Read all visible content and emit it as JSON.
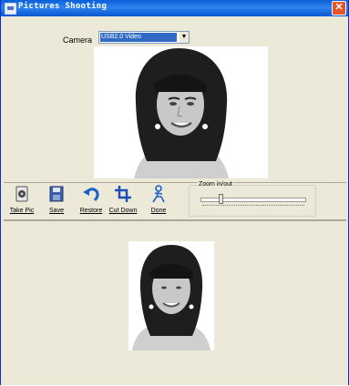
{
  "window": {
    "title": "Pictures Shooting",
    "close_glyph": "✕"
  },
  "camera": {
    "label": "Camera",
    "value": "USB2.0 Video"
  },
  "toolbar": {
    "take_pic_label": "Take Pic",
    "save_label": "Save",
    "restore_label": "Restore",
    "cut_down_label": "Cut Down",
    "done_label": "Done"
  },
  "zoom": {
    "label": "Zoom in/out",
    "level": 0.18
  },
  "icons": {
    "take_pic": "camera-icon",
    "save": "floppy-disk-icon",
    "restore": "undo-arrow-icon",
    "cut_down": "crop-icon",
    "done": "figure-icon"
  },
  "colors": {
    "titlebar": "#0a5fd8",
    "window_bg": "#ece9d8",
    "selection": "#316ac5",
    "close_button": "#e5542b"
  }
}
